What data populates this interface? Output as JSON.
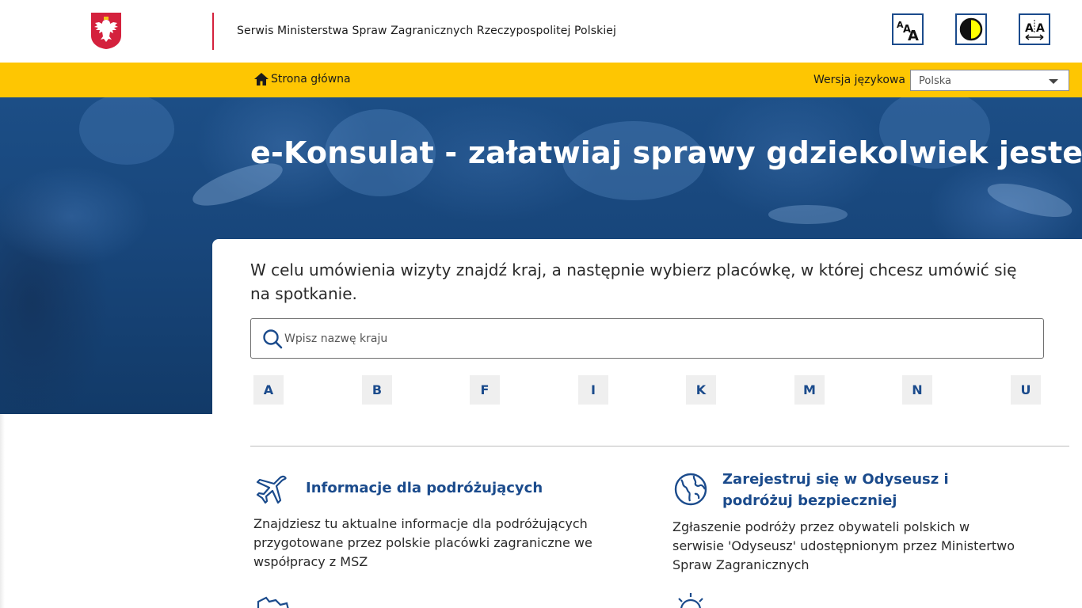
{
  "header": {
    "title": "Serwis Ministerstwa Spraw Zagranicznych Rzeczypospolitej Polskiej",
    "accessibility": {
      "font_size_icon": "font-size-icon",
      "contrast_icon": "contrast-icon",
      "letter_spacing_icon": "letter-spacing-icon"
    }
  },
  "nav": {
    "home_label": "Strona główna",
    "language_label": "Wersja językowa",
    "language_value": "Polska"
  },
  "hero": {
    "title": "e-Konsulat - załatwiaj sprawy gdziekolwiek jesteś!"
  },
  "main": {
    "intro": "W celu umówienia wizyty znajdź kraj, a następnie wybierz placówkę, w której chcesz umówić się na spotkanie.",
    "search_placeholder": "Wpisz nazwę kraju",
    "letters": [
      "A",
      "B",
      "F",
      "I",
      "K",
      "M",
      "N",
      "U"
    ],
    "info": [
      {
        "icon": "airplane-icon",
        "title": "Informacje dla podróżujących",
        "text": "Znajdziesz tu aktualne informacje dla podróżujących przygotowane przez polskie placówki zagraniczne we współpracy z MSZ"
      },
      {
        "icon": "globe-icon",
        "title": "Zarejestruj się w Odyseusz i podróżuj bezpieczniej",
        "text": "Zgłaszenie podróży przez obywateli polskich w serwisie 'Odyseusz' udostępnionym przez Ministertwo Spraw Zagranicznych"
      }
    ]
  },
  "colors": {
    "accent_yellow": "#fec602",
    "brand_blue": "#1b4b8c",
    "divider_red": "#d4213d"
  }
}
